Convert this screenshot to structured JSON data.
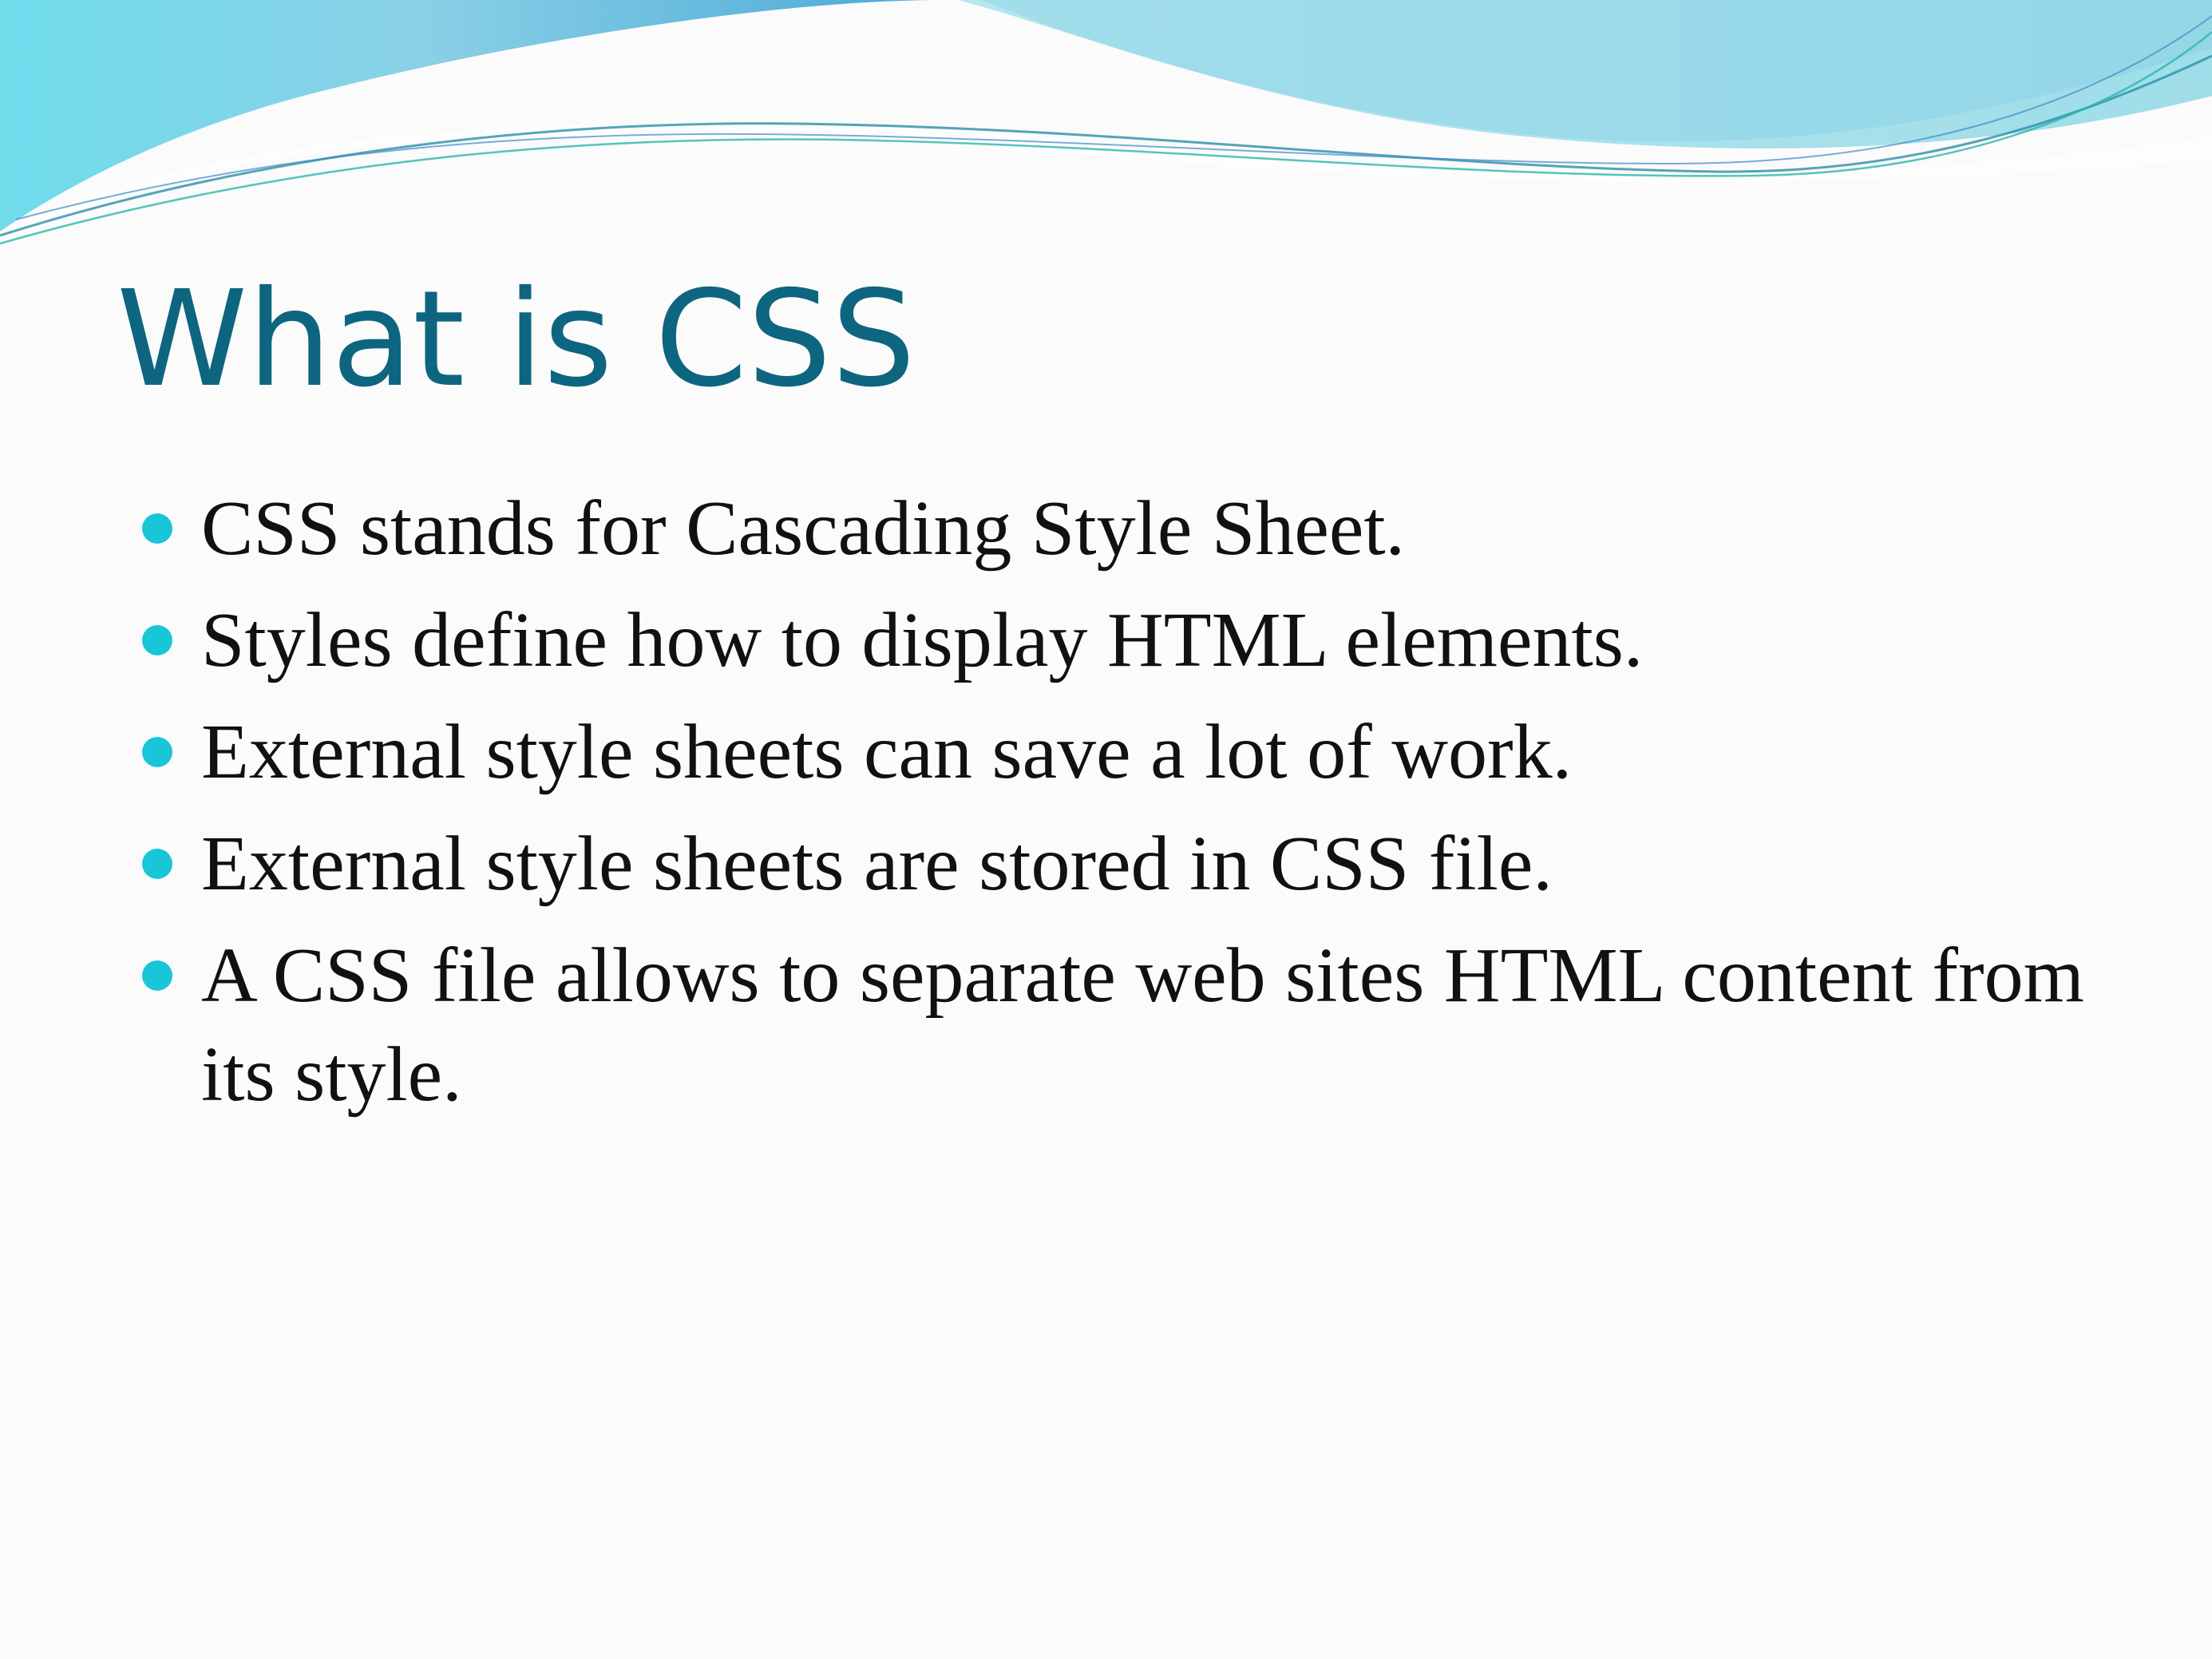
{
  "slide": {
    "title": "What is CSS",
    "bullets": [
      "CSS stands for Cascading Style Sheet.",
      "Styles define how to display HTML elements.",
      "External style sheets can save a lot of work.",
      "External style sheets are stored in CSS file.",
      "A CSS file allows to separate web sites HTML content from its style."
    ]
  },
  "colors": {
    "title": "#0e6580",
    "bullet_marker": "#18c6d8",
    "background": "#fbfbfb",
    "wave_light": "#a9e6ee",
    "wave_blue": "#57b6dd"
  }
}
